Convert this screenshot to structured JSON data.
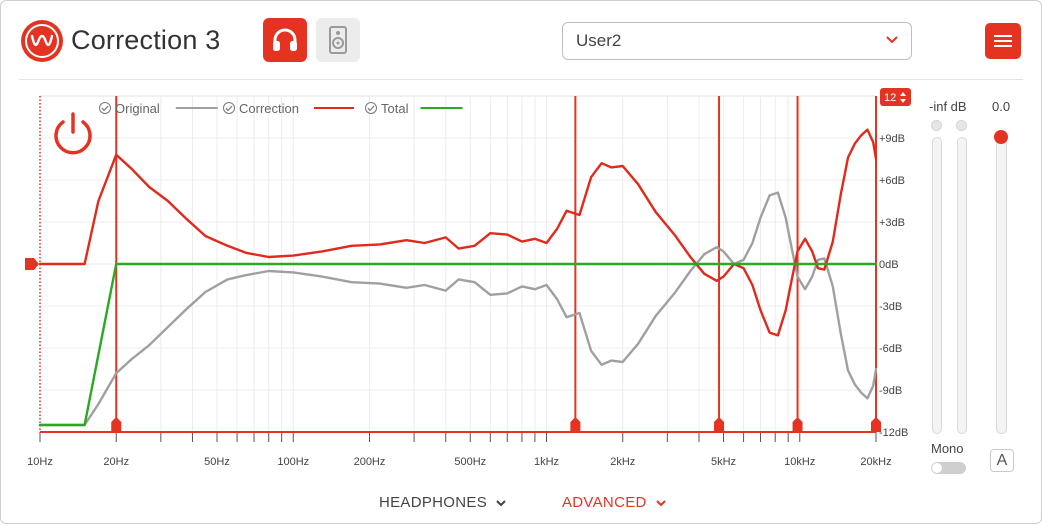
{
  "app": {
    "title": "Correction 3"
  },
  "header": {
    "preset_value": "User2",
    "headphone_mode_icon": "headphones-icon",
    "speaker_mode_icon": "speaker-icon",
    "menu_icon": "hamburger-menu-icon"
  },
  "legend": {
    "original": "Original",
    "correction": "Correction",
    "total": "Total"
  },
  "range_badge": "12",
  "meters": {
    "level_label": "-inf dB",
    "volume_label": "0.0",
    "mono_label": "Mono",
    "auto_label": "A",
    "mono_enabled": false
  },
  "bottom_tabs": {
    "headphones": "HEADPHONES",
    "advanced": "ADVANCED"
  },
  "colors": {
    "accent": "#e53322",
    "original": "#a0a0a0",
    "correction": "#e02a1c",
    "total": "#2aaa22"
  },
  "chart_data": {
    "type": "line",
    "x_scale": "log",
    "xlim": [
      10,
      20000
    ],
    "ylim": [
      -12,
      12
    ],
    "x_tick_labels": [
      {
        "v": 10,
        "label": "10Hz"
      },
      {
        "v": 20,
        "label": "20Hz"
      },
      {
        "v": 50,
        "label": "50Hz"
      },
      {
        "v": 100,
        "label": "100Hz"
      },
      {
        "v": 200,
        "label": "200Hz"
      },
      {
        "v": 500,
        "label": "500Hz"
      },
      {
        "v": 1000,
        "label": "1kHz"
      },
      {
        "v": 2000,
        "label": "2kHz"
      },
      {
        "v": 5000,
        "label": "5kHz"
      },
      {
        "v": 10000,
        "label": "10kHz"
      },
      {
        "v": 20000,
        "label": "20kHz"
      }
    ],
    "y_tick_labels": [
      {
        "v": 9,
        "label": "+9dB"
      },
      {
        "v": 6,
        "label": "+6dB"
      },
      {
        "v": 3,
        "label": "+3dB"
      },
      {
        "v": 0,
        "label": "0dB"
      },
      {
        "v": -3,
        "label": "-3dB"
      },
      {
        "v": -6,
        "label": "-6dB"
      },
      {
        "v": -9,
        "label": "-9dB"
      },
      {
        "v": -12,
        "label": "-12dB"
      }
    ],
    "grid": true,
    "markers_hz": [
      20,
      1300,
      4800,
      9800,
      20000
    ],
    "series": [
      {
        "name": "Original",
        "x": [
          10,
          15,
          17,
          20,
          23,
          27,
          32,
          38,
          45,
          55,
          65,
          80,
          100,
          130,
          170,
          220,
          280,
          330,
          400,
          450,
          520,
          600,
          700,
          800,
          900,
          1000,
          1100,
          1200,
          1350,
          1500,
          1650,
          1800,
          2000,
          2300,
          2700,
          3200,
          3700,
          4200,
          4700,
          5000,
          5500,
          6000,
          6500,
          7000,
          7600,
          8200,
          8800,
          9300,
          9800,
          10500,
          11200,
          11800,
          12500,
          13500,
          14500,
          15500,
          16500,
          17500,
          18500,
          19500,
          20000
        ],
        "y": [
          -11.5,
          -11.5,
          -10,
          -7.8,
          -6.8,
          -5.8,
          -4.5,
          -3.2,
          -2,
          -1.1,
          -0.8,
          -0.5,
          -0.6,
          -0.9,
          -1.3,
          -1.4,
          -1.7,
          -1.5,
          -1.9,
          -1.1,
          -1.3,
          -2.2,
          -2.1,
          -1.6,
          -1.8,
          -1.5,
          -2.5,
          -3.8,
          -3.5,
          -6.2,
          -7.2,
          -6.9,
          -7,
          -5.7,
          -3.7,
          -2.1,
          -0.5,
          0.7,
          1.2,
          0.9,
          0,
          0.3,
          1.5,
          3.3,
          4.9,
          5.1,
          3.3,
          1.1,
          -0.9,
          -1.8,
          -0.9,
          0.3,
          0.4,
          -1.6,
          -4.9,
          -7.6,
          -8.6,
          -9.2,
          -9.6,
          -8.7,
          -7.5
        ]
      },
      {
        "name": "Correction",
        "x": [
          10,
          15,
          17,
          20,
          23,
          27,
          32,
          38,
          45,
          55,
          65,
          80,
          100,
          130,
          170,
          220,
          280,
          330,
          400,
          450,
          520,
          600,
          700,
          800,
          900,
          1000,
          1100,
          1200,
          1350,
          1500,
          1650,
          1800,
          2000,
          2300,
          2700,
          3200,
          3700,
          4200,
          4700,
          5000,
          5500,
          6000,
          6500,
          7000,
          7600,
          8200,
          8800,
          9300,
          9800,
          10500,
          11200,
          11800,
          12500,
          13500,
          14500,
          15500,
          16500,
          17500,
          18500,
          19500,
          20000
        ],
        "y": [
          0,
          0,
          4.5,
          7.8,
          6.8,
          5.5,
          4.5,
          3.2,
          2,
          1.3,
          0.8,
          0.5,
          0.6,
          0.9,
          1.3,
          1.4,
          1.7,
          1.5,
          1.9,
          1.1,
          1.3,
          2.2,
          2.1,
          1.6,
          1.8,
          1.5,
          2.5,
          3.8,
          3.5,
          6.2,
          7.2,
          6.9,
          7,
          5.7,
          3.7,
          2.1,
          0.5,
          -0.7,
          -1.2,
          -0.9,
          0,
          -0.3,
          -1.5,
          -3.3,
          -4.9,
          -5.1,
          -3.3,
          -1.1,
          0.9,
          1.8,
          0.9,
          -0.3,
          -0.4,
          1.6,
          4.9,
          7.6,
          8.6,
          9.2,
          9.6,
          8.7,
          7.5
        ]
      },
      {
        "name": "Total",
        "x": [
          10,
          15,
          20,
          20000
        ],
        "y": [
          -11.5,
          -11.5,
          0,
          0
        ]
      }
    ]
  }
}
